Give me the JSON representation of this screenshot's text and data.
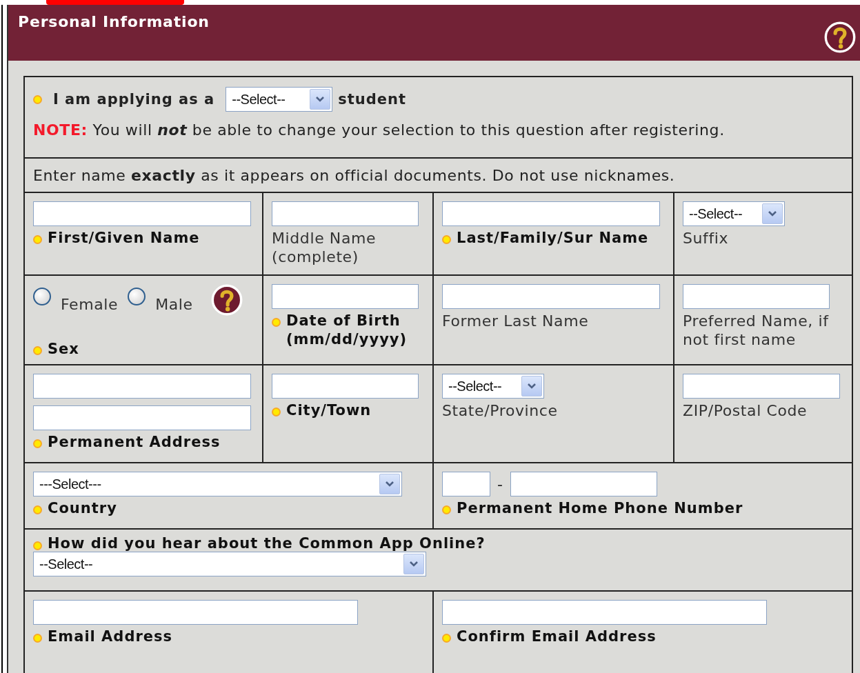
{
  "header": {
    "title": "Personal Information"
  },
  "applying": {
    "label": "I am applying as a",
    "required": true,
    "select": "--Select--",
    "suffix": "student"
  },
  "note": {
    "label": "NOTE:",
    "text": "You will **not** be able to change your selection to this question after registering."
  },
  "instruction": "Enter name **exactly** as it appears on official documents. Do not use nicknames.",
  "rows": [
    [
      {
        "kind": "text",
        "label": "First/Given Name",
        "required": true
      },
      {
        "kind": "text",
        "label": "Middle Name (complete)",
        "required": false
      },
      {
        "kind": "text",
        "label": "Last/Family/Sur Name",
        "required": true
      },
      {
        "kind": "select",
        "select": "--Select--",
        "label": "Suffix",
        "required": false
      }
    ],
    [
      {
        "kind": "radio",
        "options": [
          {
            "label": "Female",
            "selected": false
          },
          {
            "label": "Male",
            "selected": false
          }
        ],
        "label": "Sex",
        "required": true
      },
      {
        "kind": "text",
        "label": "Date of Birth (mm/dd/yyyy)",
        "required": true
      },
      {
        "kind": "text",
        "label": "Former Last Name",
        "required": false
      },
      {
        "kind": "text",
        "label": "Preferred Name, if not first name",
        "required": false
      }
    ],
    [
      {
        "kind": "address",
        "label": "Permanent Address",
        "required": true
      },
      {
        "kind": "text",
        "label": "City/Town",
        "required": true
      },
      {
        "kind": "select",
        "select": "--Select--",
        "label": "State/Province",
        "required": false
      },
      {
        "kind": "text",
        "label": "ZIP/Postal Code",
        "required": false
      }
    ],
    [
      {
        "kind": "select",
        "select": "---Select---",
        "label": "Country",
        "required": true
      },
      {
        "kind": "phone",
        "separator": "-",
        "label": "Permanent Home Phone Number",
        "required": true
      }
    ],
    [
      {
        "kind": "question",
        "select": "--Select--",
        "label": "How did you hear about the Common App Online?",
        "required": true
      }
    ],
    [
      {
        "kind": "text",
        "label": "Email Address",
        "required": true
      },
      {
        "kind": "text",
        "label": "Confirm Email Address",
        "required": true
      }
    ]
  ]
}
